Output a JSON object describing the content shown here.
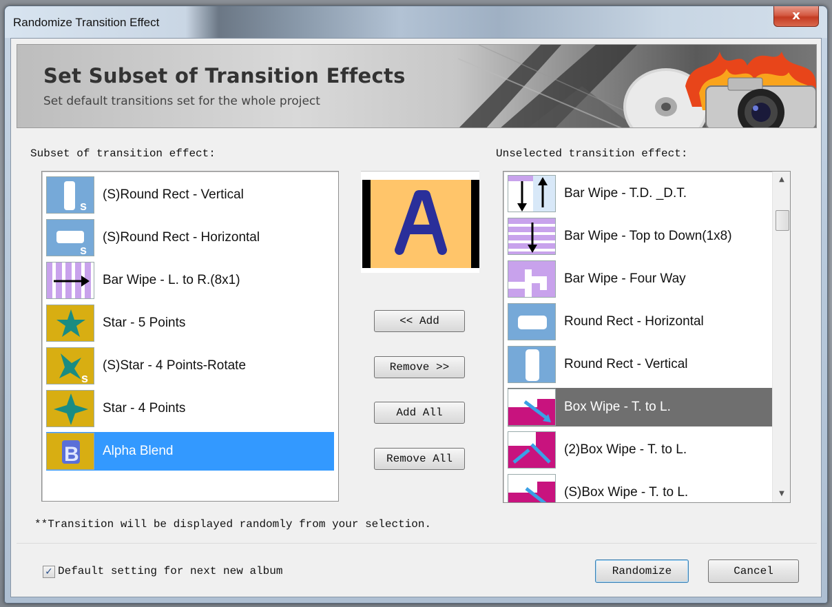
{
  "window": {
    "title": "Randomize Transition Effect",
    "close_label": "x"
  },
  "banner": {
    "title": "Set Subset of Transition Effects",
    "subtitle": "Set default transitions set for the whole project"
  },
  "subset_list": {
    "label": "Subset of transition effect:",
    "items": [
      {
        "label": "(S)Round Rect - Vertical",
        "icon": "round-rect-vertical-s"
      },
      {
        "label": "(S)Round Rect - Horizontal",
        "icon": "round-rect-horizontal-s"
      },
      {
        "label": "Bar Wipe - L. to R.(8x1)",
        "icon": "bar-wipe-l-to-r"
      },
      {
        "label": "Star - 5 Points",
        "icon": "star-5"
      },
      {
        "label": "(S)Star - 4 Points-Rotate",
        "icon": "star-4-rotate-s"
      },
      {
        "label": "Star - 4 Points",
        "icon": "star-4"
      },
      {
        "label": "Alpha Blend",
        "icon": "alpha-blend"
      }
    ],
    "selected_index": 6
  },
  "unselected_list": {
    "label": "Unselected transition effect:",
    "items": [
      {
        "label": "Bar Wipe - T.D. _D.T.",
        "icon": "bar-wipe-td-dt"
      },
      {
        "label": "Bar Wipe - Top to Down(1x8)",
        "icon": "bar-wipe-top-down"
      },
      {
        "label": "Bar Wipe - Four Way",
        "icon": "bar-wipe-four-way"
      },
      {
        "label": "Round Rect - Horizontal",
        "icon": "round-rect-horizontal"
      },
      {
        "label": "Round Rect - Vertical",
        "icon": "round-rect-vertical"
      },
      {
        "label": "Box Wipe - T. to L.",
        "icon": "box-wipe"
      },
      {
        "label": "(2)Box Wipe - T. to L.",
        "icon": "box-wipe-2"
      },
      {
        "label": "(S)Box Wipe - T. to L.",
        "icon": "box-wipe-s"
      }
    ],
    "selected_index": 5,
    "scroll_up": "▲",
    "scroll_down": "▼"
  },
  "preview": {
    "letter": "A",
    "colors": {
      "background": "#ffc56a",
      "letter": "#2a2f9a"
    }
  },
  "buttons": {
    "add": "<< Add",
    "remove": "Remove >>",
    "add_all": "Add All",
    "remove_all": "Remove All",
    "randomize": "Randomize",
    "cancel": "Cancel"
  },
  "note": "**Transition will be displayed randomly from your selection.",
  "default_setting": {
    "label": "Default setting for next new album",
    "checked": true,
    "check_glyph": "✓"
  },
  "colors": {
    "selection_blue": "#3399ff",
    "selection_gray": "#6f6f6f",
    "thumb_blue": "#76a9d8",
    "thumb_purple": "#c8a2ec",
    "thumb_gold": "#d8ae12",
    "thumb_teal": "#1a8c82",
    "thumb_magenta": "#c8137e"
  }
}
